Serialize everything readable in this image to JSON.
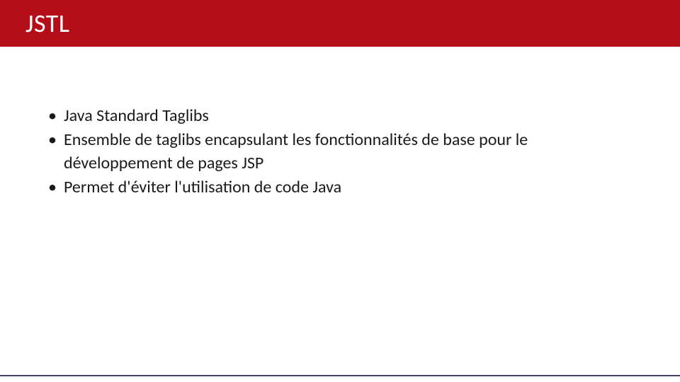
{
  "header": {
    "title": "JSTL"
  },
  "content": {
    "bullets": [
      "Java Standard Taglibs",
      "Ensemble de taglibs encapsulant les fonctionnalités de base pour le développement de pages JSP",
      "Permet d'éviter l'utilisation de code Java"
    ]
  }
}
